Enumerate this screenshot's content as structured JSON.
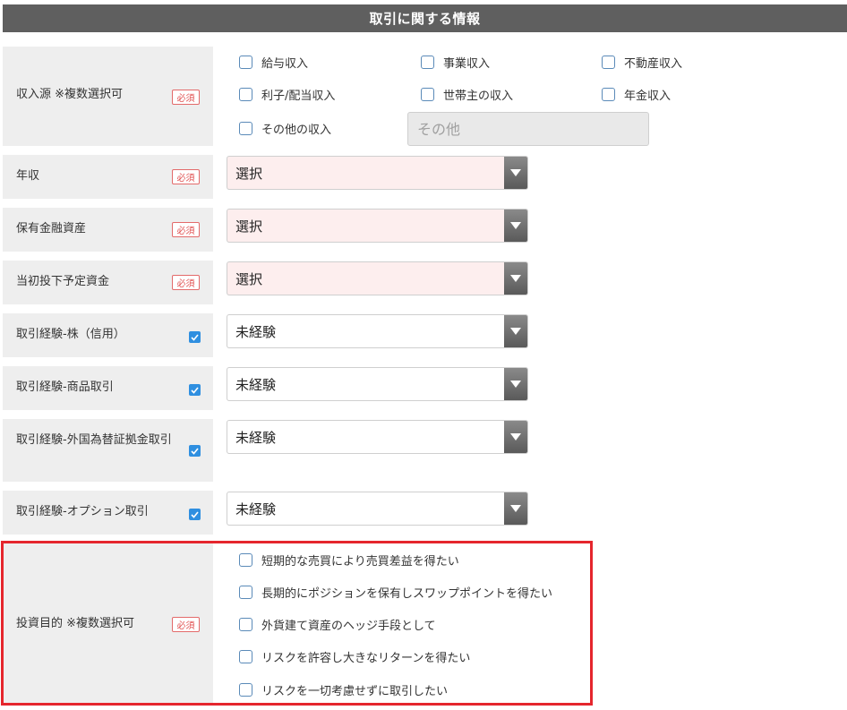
{
  "header": {
    "title": "取引に関する情報"
  },
  "badges": {
    "required": "必須"
  },
  "income_source": {
    "label": "収入源 ※複数選択可",
    "options": [
      "給与収入",
      "事業収入",
      "不動産収入",
      "利子/配当収入",
      "世帯主の収入",
      "年金収入",
      "その他の収入"
    ],
    "other_placeholder": "その他"
  },
  "annual_income": {
    "label": "年収",
    "value": "選択"
  },
  "financial_assets": {
    "label": "保有金融資産",
    "value": "選択"
  },
  "initial_investment": {
    "label": "当初投下予定資金",
    "value": "選択"
  },
  "exp_stock_margin": {
    "label": "取引経験-株（信用）",
    "value": "未経験"
  },
  "exp_commodity": {
    "label": "取引経験-商品取引",
    "value": "未経験"
  },
  "exp_fx": {
    "label": "取引経験-外国為替証拠金取引",
    "value": "未経験"
  },
  "exp_options": {
    "label": "取引経験-オプション取引",
    "value": "未経験"
  },
  "investment_purpose": {
    "label": "投資目的 ※複数選択可",
    "options": [
      "短期的な売買により売買差益を得たい",
      "長期的にポジションを保有しスワップポイントを得たい",
      "外貨建て資産のヘッジ手段として",
      "リスクを許容し大きなリターンを得たい",
      "リスクを一切考慮せずに取引したい"
    ]
  },
  "colors": {
    "header_bg": "#5f5f5f",
    "label_bg": "#eeeeee",
    "required_select_bg": "#fdeeee",
    "required_badge": "#e05050",
    "check_blue": "#2f8fe0",
    "highlight_border": "#e5262d"
  }
}
